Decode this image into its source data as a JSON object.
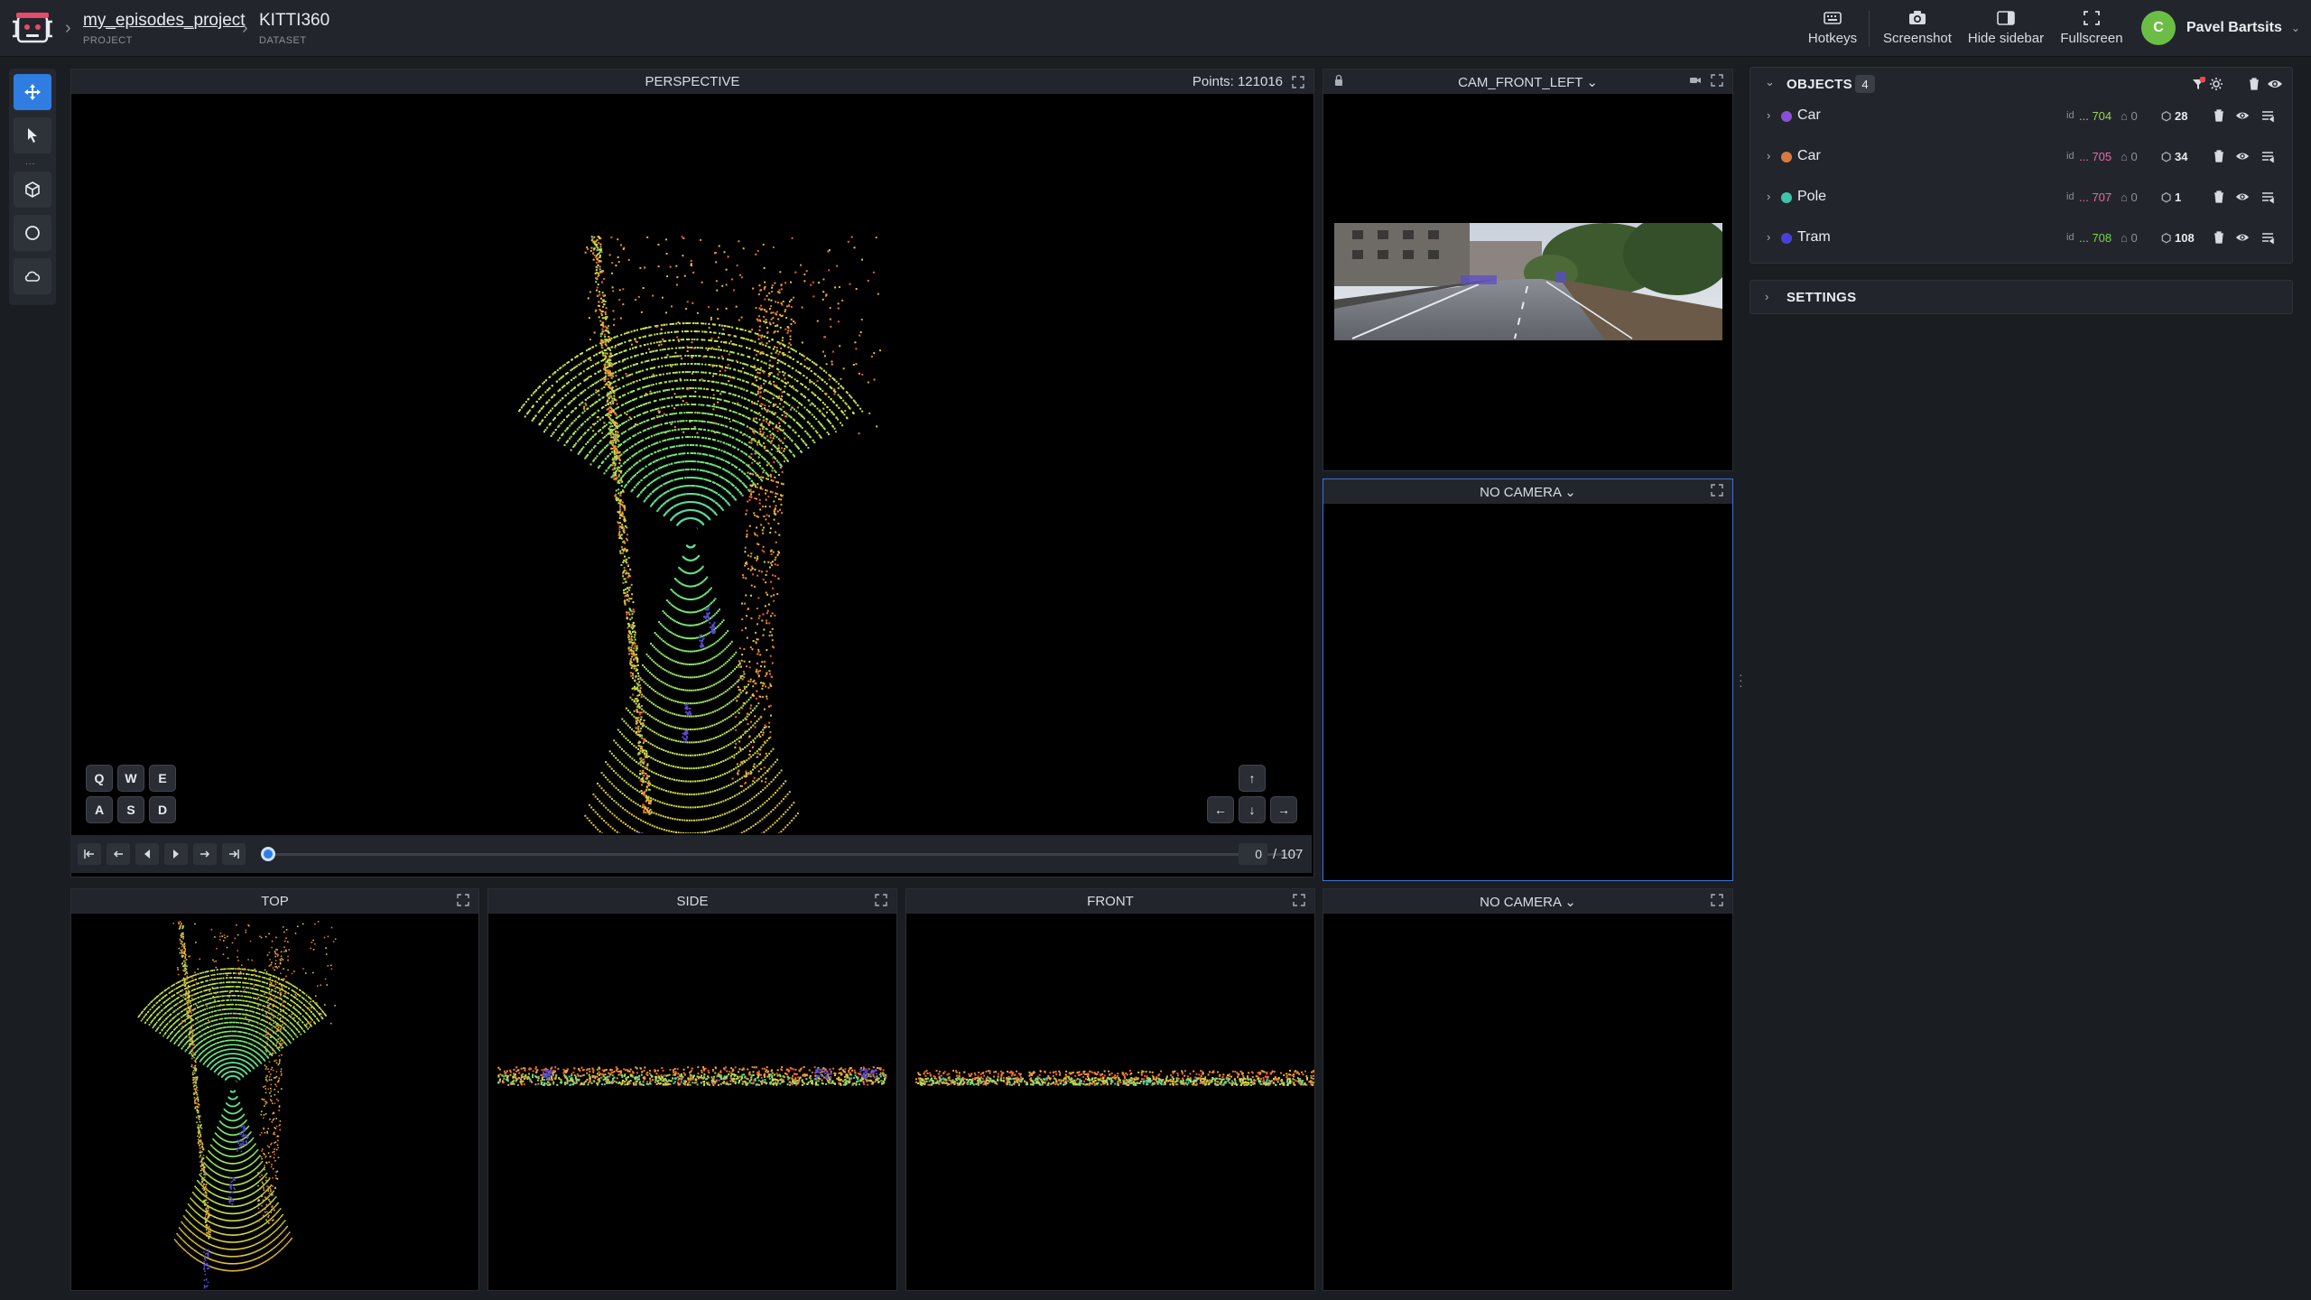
{
  "header": {
    "project_name": "my_episodes_project",
    "project_label": "PROJECT",
    "dataset_name": "KITTI360",
    "dataset_label": "DATASET",
    "buttons": {
      "hotkeys": "Hotkeys",
      "screenshot": "Screenshot",
      "hide_sidebar": "Hide sidebar",
      "fullscreen": "Fullscreen"
    },
    "user": {
      "initial": "C",
      "name": "Pavel Bartsits"
    }
  },
  "toolbar": {
    "tools": [
      "move-icon",
      "select-arrow-icon",
      "cuboid-icon",
      "circle-icon",
      "cloud-icon"
    ],
    "more": "..."
  },
  "views": {
    "perspective": {
      "title": "PERSPECTIVE",
      "points_label": "Points: 121016"
    },
    "cam1": {
      "title": "CAM_FRONT_LEFT"
    },
    "cam2": {
      "title": "NO CAMERA"
    },
    "top": {
      "title": "TOP"
    },
    "side": {
      "title": "SIDE"
    },
    "front": {
      "title": "FRONT"
    },
    "cam3": {
      "title": "NO CAMERA"
    }
  },
  "keys": {
    "row1": [
      "Q",
      "W",
      "E"
    ],
    "row2": [
      "A",
      "S",
      "D"
    ]
  },
  "player": {
    "frame": "0",
    "total": "/ 107",
    "progress": 0
  },
  "objects": {
    "title": "OBJECTS",
    "count": "4",
    "items": [
      {
        "cls": "Car",
        "color": "#8a4fd8",
        "id_label": "id",
        "id": "... 704",
        "id_color": "#9bd447",
        "tags": "0",
        "points": "28"
      },
      {
        "cls": "Car",
        "color": "#d77a3f",
        "id_label": "id",
        "id": "... 705",
        "id_color": "#e56aa8",
        "tags": "0",
        "points": "34"
      },
      {
        "cls": "Pole",
        "color": "#3fc4a8",
        "id_label": "id",
        "id": "... 707",
        "id_color": "#e56aa8",
        "tags": "0",
        "points": "1"
      },
      {
        "cls": "Tram",
        "color": "#4b3fd8",
        "id_label": "id",
        "id": "... 708",
        "id_color": "#7cd447",
        "tags": "0",
        "points": "108"
      }
    ]
  },
  "settings": {
    "title": "SETTINGS"
  },
  "colors": {
    "accent": "#2f7de1",
    "panel_head": "#22262c",
    "background": "#1a1d21"
  }
}
